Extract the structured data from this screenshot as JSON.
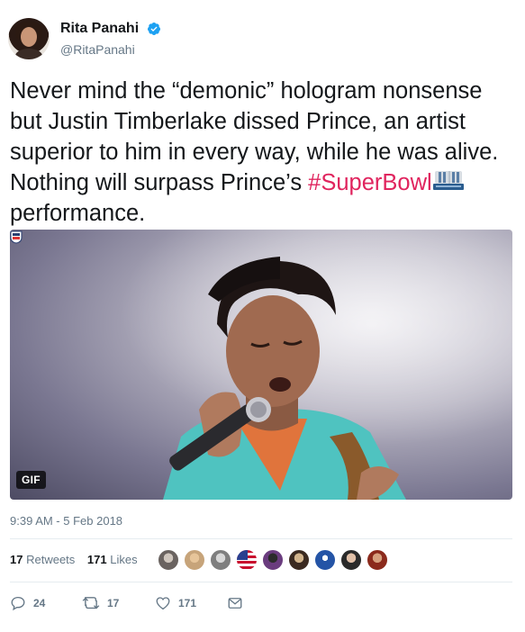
{
  "author": {
    "display_name": "Rita Panahi",
    "handle": "@RitaPanahi",
    "verified": true
  },
  "tweet": {
    "text_part1": "Never mind the “demonic” hologram nonsense but Justin Timberlake dissed Prince, an artist superior to him in every way, while he was alive. Nothing will surpass Prince’s ",
    "hashtag": "#SuperBowl",
    "text_part2": " performance."
  },
  "media": {
    "badge": "GIF"
  },
  "timestamp": "9:39 AM - 5 Feb 2018",
  "stats": {
    "retweets_count": "17",
    "retweets_label": "Retweets",
    "likes_count": "171",
    "likes_label": "Likes"
  },
  "actions": {
    "reply_count": "24",
    "retweet_count": "17",
    "like_count": "171"
  },
  "colors": {
    "hashtag": "#e0245e",
    "verified": "#1da1f2",
    "muted": "#657786"
  }
}
